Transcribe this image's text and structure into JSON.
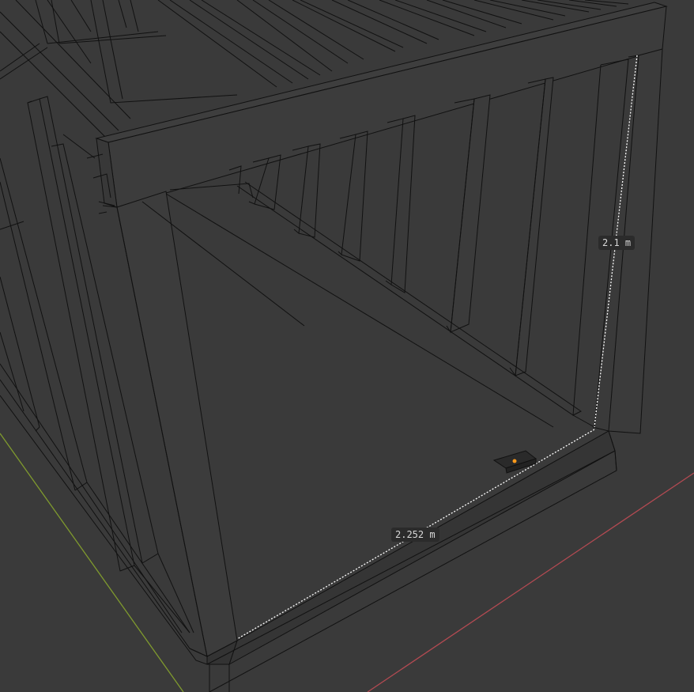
{
  "viewport": {
    "background_color": "#3a3a3a",
    "line_color": "#111111",
    "x_axis_color": "#b34a52",
    "y_axis_color": "#7f9a2e",
    "origin_marker_color": "#ff9a1a"
  },
  "dimensions": {
    "height_label": "2.1 m",
    "width_label": "2.252 m"
  }
}
